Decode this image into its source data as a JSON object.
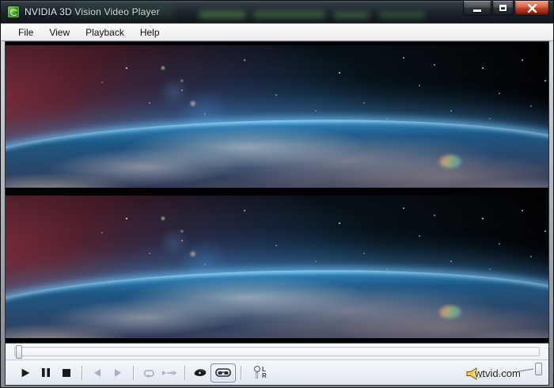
{
  "window": {
    "title": "NVIDIA 3D Vision Video Player",
    "controls": [
      "minimize-icon",
      "maximize-icon",
      "close-icon"
    ]
  },
  "menu": {
    "items": [
      "File",
      "View",
      "Playback",
      "Help"
    ]
  },
  "video": {
    "mode": "stereoscopic-over-under",
    "frames": [
      "top-eye-frame",
      "bottom-eye-frame"
    ]
  },
  "transport": {
    "buttons": [
      {
        "name": "play",
        "enabled": true
      },
      {
        "name": "pause",
        "enabled": true
      },
      {
        "name": "stop",
        "enabled": true
      },
      {
        "name": "previous",
        "enabled": false
      },
      {
        "name": "next",
        "enabled": false
      },
      {
        "name": "loop",
        "enabled": false
      },
      {
        "name": "skip",
        "enabled": false
      },
      {
        "name": "eye-2d-view",
        "enabled": true,
        "active": false
      },
      {
        "name": "glasses-3d-view",
        "enabled": true,
        "active": true
      }
    ],
    "lr_toggle": {
      "top": "L",
      "bottom": "R",
      "position": "L"
    }
  },
  "seekbar": {
    "position_percent": 0
  },
  "volume": {
    "level_percent": 100
  },
  "watermark": "wtvid.com",
  "colors": {
    "titlebar": "#1b232b",
    "close_button": "#bb3c22",
    "toolbar_bg": "#e9eef5",
    "atmosphere_blue": "#49a4d9",
    "flare_red": "#983a4a"
  }
}
